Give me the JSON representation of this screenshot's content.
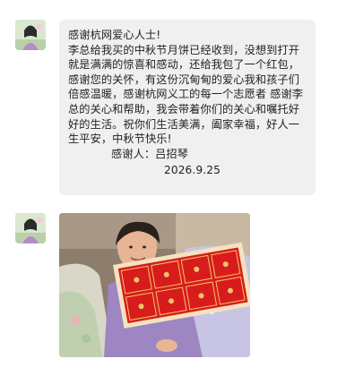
{
  "messages": [
    {
      "type": "text",
      "lines": [
        "感谢杭网爱心人士!",
        "李总给我买的中秋节月饼已经收到，没想到打开就是满满的惊喜和感动，还给我包了一个红包，感谢您的关怀，有这份沉甸甸的爱心我和孩子们倍感温暖，感谢杭网义工的每一个志愿者 感谢李总的关心和帮助，我会带着你们的关心和嘱托好好的生活。祝你们生活美满，阖家幸福，好人一生平安，中秋节快乐!"
      ],
      "signature": "感谢人：吕招琴",
      "date": "2026.9.25"
    },
    {
      "type": "image",
      "image_icon": "photo-woman-with-mooncake-box"
    }
  ],
  "colors": {
    "bubble_bg": "#f0f0f0",
    "text": "#222222",
    "box_red": "#d81c1c"
  }
}
